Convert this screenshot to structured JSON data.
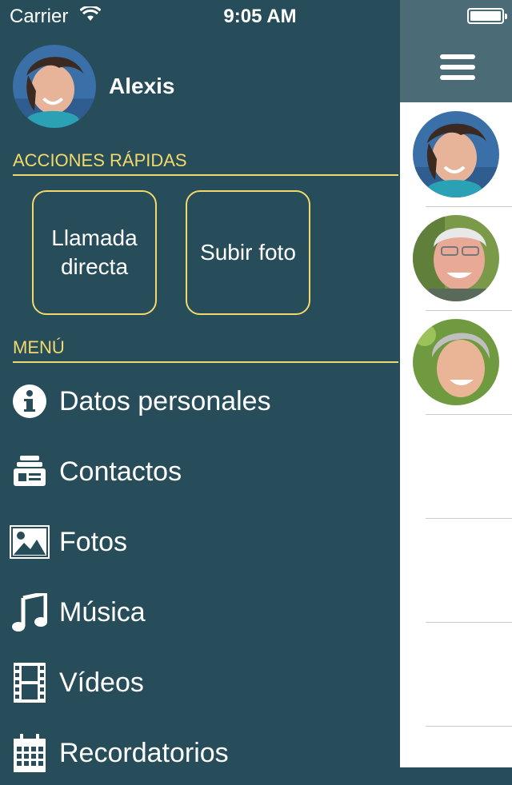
{
  "status_bar": {
    "carrier": "Carrier",
    "time": "9:05 AM"
  },
  "profile": {
    "name": "Alexis"
  },
  "quick_actions": {
    "title": "ACCIONES RÁPIDAS",
    "buttons": [
      {
        "label_line1": "Llamada",
        "label_line2": "directa"
      },
      {
        "label": "Subir foto"
      }
    ]
  },
  "menu": {
    "title": "MENÚ",
    "items": [
      {
        "label": "Datos personales",
        "icon": "info-icon"
      },
      {
        "label": "Contactos",
        "icon": "contacts-icon"
      },
      {
        "label": "Fotos",
        "icon": "photo-icon"
      },
      {
        "label": "Música",
        "icon": "music-icon"
      },
      {
        "label": "Vídeos",
        "icon": "film-icon"
      },
      {
        "label": "Recordatorios",
        "icon": "calendar-icon"
      }
    ]
  },
  "colors": {
    "sidebar_bg": "#274d5a",
    "header_bg": "#4b6b76",
    "accent": "#f2d96b",
    "text": "#ffffff"
  }
}
